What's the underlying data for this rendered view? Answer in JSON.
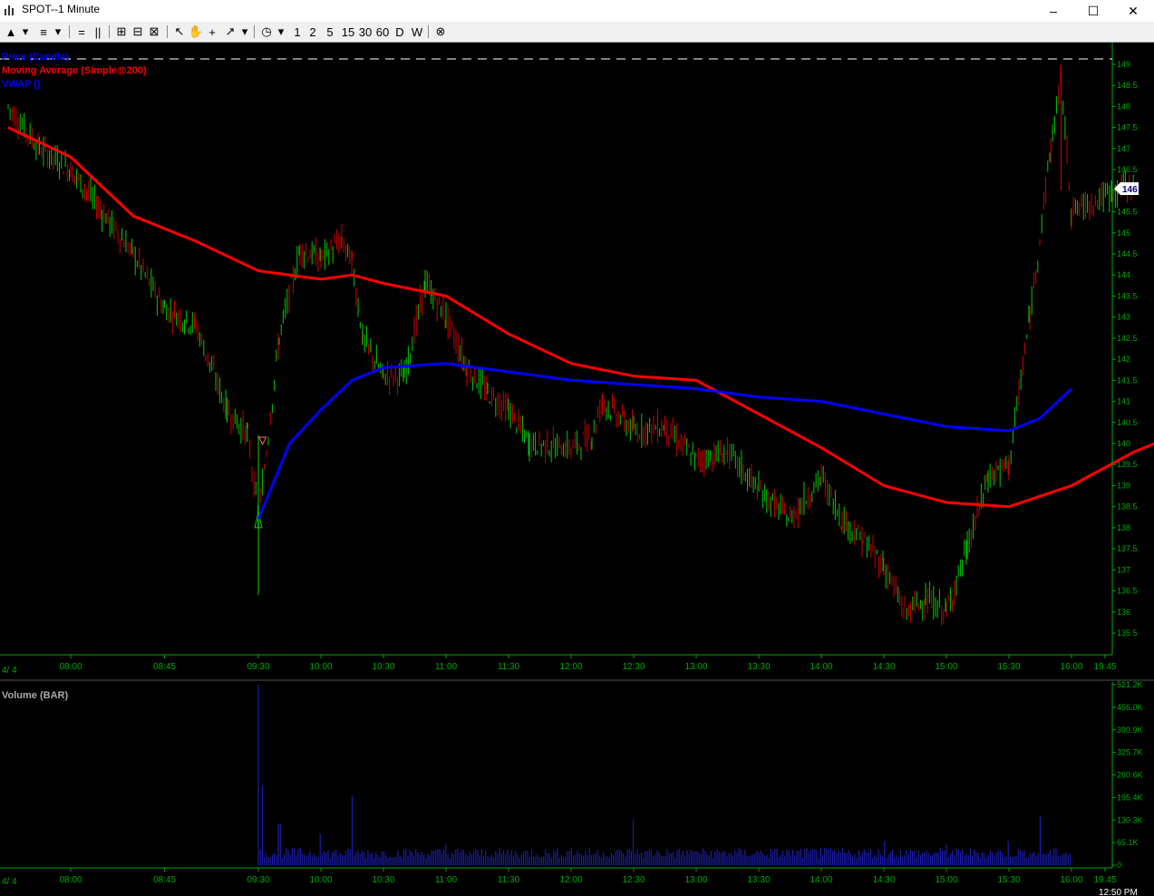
{
  "window": {
    "title": "SPOT--1 Minute"
  },
  "toolbar": {
    "intervals": [
      "1",
      "2",
      "5",
      "15",
      "30",
      "60",
      "D",
      "W"
    ]
  },
  "legend": {
    "price": "Price (Candle)",
    "ma": "Moving Average (Simple@200)",
    "vwap": "VWAP ()"
  },
  "volume_title": "Volume (BAR)",
  "date_label": "4/ 4",
  "last_price_label": "146",
  "clock": "12:50 PM",
  "colors": {
    "ma": "#ff0000",
    "vwap": "#0000ff",
    "up": "#00cc00",
    "down": "#cc0000",
    "axis": "#00aa00",
    "bg": "#000000"
  },
  "chart_data": [
    {
      "type": "line",
      "title": "",
      "x_ticks": [
        "08:00",
        "08:45",
        "09:30",
        "10:00",
        "10:30",
        "11:00",
        "11:30",
        "12:00",
        "12:30",
        "13:00",
        "13:30",
        "14:00",
        "14:30",
        "15:00",
        "15:30",
        "16:00",
        "19:45"
      ],
      "y_ticks": [
        "135.5",
        "136",
        "136.5",
        "137",
        "137.5",
        "138",
        "138.5",
        "139",
        "139.5",
        "140",
        "140.5",
        "141",
        "141.5",
        "142",
        "142.5",
        "143",
        "143.5",
        "144",
        "144.5",
        "145",
        "145.5",
        "146",
        "146.5",
        "147",
        "147.5",
        "148",
        "148.5",
        "149"
      ],
      "ylim": [
        135.2,
        149.3
      ],
      "series": [
        {
          "name": "Price (Candle)",
          "points": [
            [
              "07:30",
              148
            ],
            [
              "07:45",
              147
            ],
            [
              "08:00",
              146.5
            ],
            [
              "08:15",
              145.5
            ],
            [
              "08:30",
              144.5
            ],
            [
              "08:45",
              143.2
            ],
            [
              "09:00",
              142.8
            ],
            [
              "09:15",
              140.8
            ],
            [
              "09:25",
              140.2
            ],
            [
              "09:30",
              138.2
            ],
            [
              "09:40",
              142.5
            ],
            [
              "09:50",
              144.6
            ],
            [
              "10:00",
              144.4
            ],
            [
              "10:10",
              144.8
            ],
            [
              "10:15",
              144.3
            ],
            [
              "10:20",
              142.5
            ],
            [
              "10:30",
              141.6
            ],
            [
              "10:40",
              141.6
            ],
            [
              "10:50",
              143.8
            ],
            [
              "11:00",
              143.0
            ],
            [
              "11:10",
              141.8
            ],
            [
              "11:20",
              141.2
            ],
            [
              "11:30",
              140.8
            ],
            [
              "11:40",
              140.0
            ],
            [
              "12:00",
              139.9
            ],
            [
              "12:10",
              140.2
            ],
            [
              "12:15",
              141.0
            ],
            [
              "12:30",
              140.3
            ],
            [
              "12:45",
              140.4
            ],
            [
              "13:00",
              139.6
            ],
            [
              "13:15",
              139.8
            ],
            [
              "13:30",
              138.9
            ],
            [
              "13:45",
              138.2
            ],
            [
              "14:00",
              139.2
            ],
            [
              "14:10",
              138.2
            ],
            [
              "14:20",
              137.7
            ],
            [
              "14:30",
              137.1
            ],
            [
              "14:40",
              136.0
            ],
            [
              "14:50",
              136.3
            ],
            [
              "15:00",
              136.0
            ],
            [
              "15:10",
              137.5
            ],
            [
              "15:20",
              139.2
            ],
            [
              "15:30",
              139.5
            ],
            [
              "15:40",
              143.0
            ],
            [
              "15:50",
              147.0
            ],
            [
              "15:55",
              148.7
            ],
            [
              "16:00",
              145.5
            ],
            [
              "16:30",
              146.2
            ]
          ]
        },
        {
          "name": "Moving Average (Simple@200)",
          "points": [
            [
              "07:30",
              147.5
            ],
            [
              "08:00",
              146.8
            ],
            [
              "08:30",
              145.4
            ],
            [
              "09:00",
              144.8
            ],
            [
              "09:30",
              144.1
            ],
            [
              "10:00",
              143.9
            ],
            [
              "10:15",
              144.0
            ],
            [
              "10:30",
              143.8
            ],
            [
              "11:00",
              143.5
            ],
            [
              "11:30",
              142.6
            ],
            [
              "12:00",
              141.9
            ],
            [
              "12:30",
              141.6
            ],
            [
              "13:00",
              141.5
            ],
            [
              "13:30",
              140.7
            ],
            [
              "14:00",
              139.9
            ],
            [
              "14:30",
              139.0
            ],
            [
              "15:00",
              138.6
            ],
            [
              "15:30",
              138.5
            ],
            [
              "16:00",
              139.0
            ],
            [
              "16:30",
              139.8
            ],
            [
              "17:00",
              140.4
            ]
          ]
        },
        {
          "name": "VWAP ()",
          "points": [
            [
              "09:30",
              138.2
            ],
            [
              "09:45",
              140.0
            ],
            [
              "10:00",
              140.8
            ],
            [
              "10:15",
              141.5
            ],
            [
              "10:30",
              141.8
            ],
            [
              "11:00",
              141.9
            ],
            [
              "11:30",
              141.7
            ],
            [
              "12:00",
              141.5
            ],
            [
              "12:30",
              141.4
            ],
            [
              "13:00",
              141.3
            ],
            [
              "13:30",
              141.1
            ],
            [
              "14:00",
              141.0
            ],
            [
              "14:30",
              140.7
            ],
            [
              "15:00",
              140.4
            ],
            [
              "15:30",
              140.3
            ],
            [
              "15:45",
              140.6
            ],
            [
              "16:00",
              141.3
            ]
          ]
        }
      ]
    },
    {
      "type": "bar",
      "title": "Volume (BAR)",
      "y_ticks": [
        "0",
        "65.1K",
        "130.3K",
        "195.4K",
        "260.6K",
        "325.7K",
        "390.9K",
        "456.0K",
        "521.2K"
      ],
      "ylim": [
        0,
        521200
      ],
      "x_ticks": [
        "08:00",
        "08:45",
        "09:30",
        "10:00",
        "10:30",
        "11:00",
        "11:30",
        "12:00",
        "12:30",
        "13:00",
        "13:30",
        "14:00",
        "14:30",
        "15:00",
        "15:30",
        "16:00",
        "19:45"
      ],
      "series": [
        {
          "name": "Volume",
          "points": [
            [
              "09:30",
              521200
            ],
            [
              "09:32",
              230000
            ],
            [
              "09:40",
              120000
            ],
            [
              "10:00",
              90000
            ],
            [
              "10:15",
              200000
            ],
            [
              "11:00",
              60000
            ],
            [
              "12:00",
              50000
            ],
            [
              "12:30",
              130000
            ],
            [
              "13:00",
              40000
            ],
            [
              "14:00",
              50000
            ],
            [
              "14:30",
              70000
            ],
            [
              "15:00",
              60000
            ],
            [
              "15:30",
              70000
            ],
            [
              "15:45",
              140000
            ],
            [
              "16:00",
              130000
            ]
          ]
        }
      ]
    }
  ]
}
